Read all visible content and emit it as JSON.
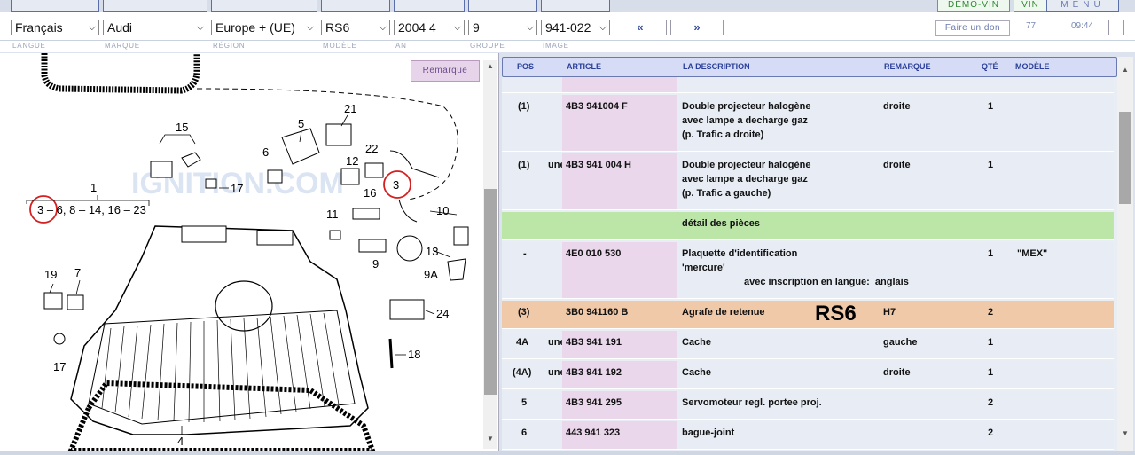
{
  "header": {
    "demo_vin": "DÉMO-VIN",
    "vin": "VIN",
    "menu": "MENU"
  },
  "selectors": {
    "langue": "Français",
    "marque": "Audi",
    "region": "Europe + (UE)",
    "modele": "RS6",
    "an": "2004 4",
    "groupe": "9",
    "image": "941-022"
  },
  "nav": {
    "prev": "«",
    "next": "»"
  },
  "donate": "Faire un don",
  "counter": "77",
  "time": "09:44",
  "labels": {
    "langue": "LANGUE",
    "marque": "MARQUE",
    "region": "RÉGION",
    "modele": "MODÈLE",
    "an": "AN",
    "groupe": "GROUPE",
    "image": "IMAGE"
  },
  "remarque_button": "Remarque",
  "table": {
    "headers": {
      "pos": "POS",
      "article": "ARTICLE",
      "description": "LA DESCRIPTION",
      "remarque": "REMARQUE",
      "qte": "QTÉ",
      "modele": "MODÈLE"
    },
    "rows": [
      {
        "pos": "(1)",
        "flag": "",
        "article": "4B3 941004 F",
        "desc1": "Double projecteur halogène",
        "desc2": "avec lampe a decharge gaz",
        "desc3": "(p. Trafic a droite)",
        "remarque": "droite",
        "qte": "1",
        "modele": ""
      },
      {
        "pos": "(1)",
        "flag": "une",
        "article": "4B3 941 004 H",
        "desc1": "Double projecteur halogène",
        "desc2": "avec lampe a decharge gaz",
        "desc3": "(p. Trafic a gauche)",
        "remarque": "droite",
        "qte": "1",
        "modele": ""
      },
      {
        "section": "détail des pièces"
      },
      {
        "pos": "-",
        "flag": "",
        "article": "4E0 010 530",
        "desc1": "Plaquette d'identification",
        "desc2": "'mercure'",
        "desc3": "avec inscription en langue:  anglais",
        "remarque": "",
        "qte": "1",
        "modele": "\"MEX\""
      },
      {
        "pos": "(3)",
        "flag": "",
        "article": "3B0 941160 B",
        "desc1": "Agrafe de retenue",
        "desc2": "",
        "desc3": "",
        "remarque": "H7",
        "qte": "2",
        "modele": "",
        "overlay": "RS6"
      },
      {
        "pos": "4A",
        "flag": "une",
        "article": "4B3 941 191",
        "desc1": "Cache",
        "desc2": "",
        "desc3": "",
        "remarque": "gauche",
        "qte": "1",
        "modele": ""
      },
      {
        "pos": "(4A)",
        "flag": "une",
        "article": "4B3 941 192",
        "desc1": "Cache",
        "desc2": "",
        "desc3": "",
        "remarque": "droite",
        "qte": "1",
        "modele": ""
      },
      {
        "pos": "5",
        "flag": "",
        "article": "4B3 941 295",
        "desc1": "Servomoteur regl. portee proj.",
        "desc2": "",
        "desc3": "",
        "remarque": "",
        "qte": "2",
        "modele": ""
      },
      {
        "pos": "6",
        "flag": "",
        "article": "443 941 323",
        "desc1": "bague-joint",
        "desc2": "",
        "desc3": "",
        "remarque": "",
        "qte": "2",
        "modele": ""
      }
    ]
  },
  "diagram": {
    "callouts": [
      "15",
      "5",
      "21",
      "22",
      "6",
      "12",
      "3",
      "1",
      "17",
      "16",
      "10",
      "3 – 6, 8 – 14, 16 – 23",
      "11",
      "13",
      "9",
      "9A",
      "19",
      "7",
      "24",
      "17",
      "18",
      "4"
    ],
    "watermark": "IGNITION.COM"
  }
}
